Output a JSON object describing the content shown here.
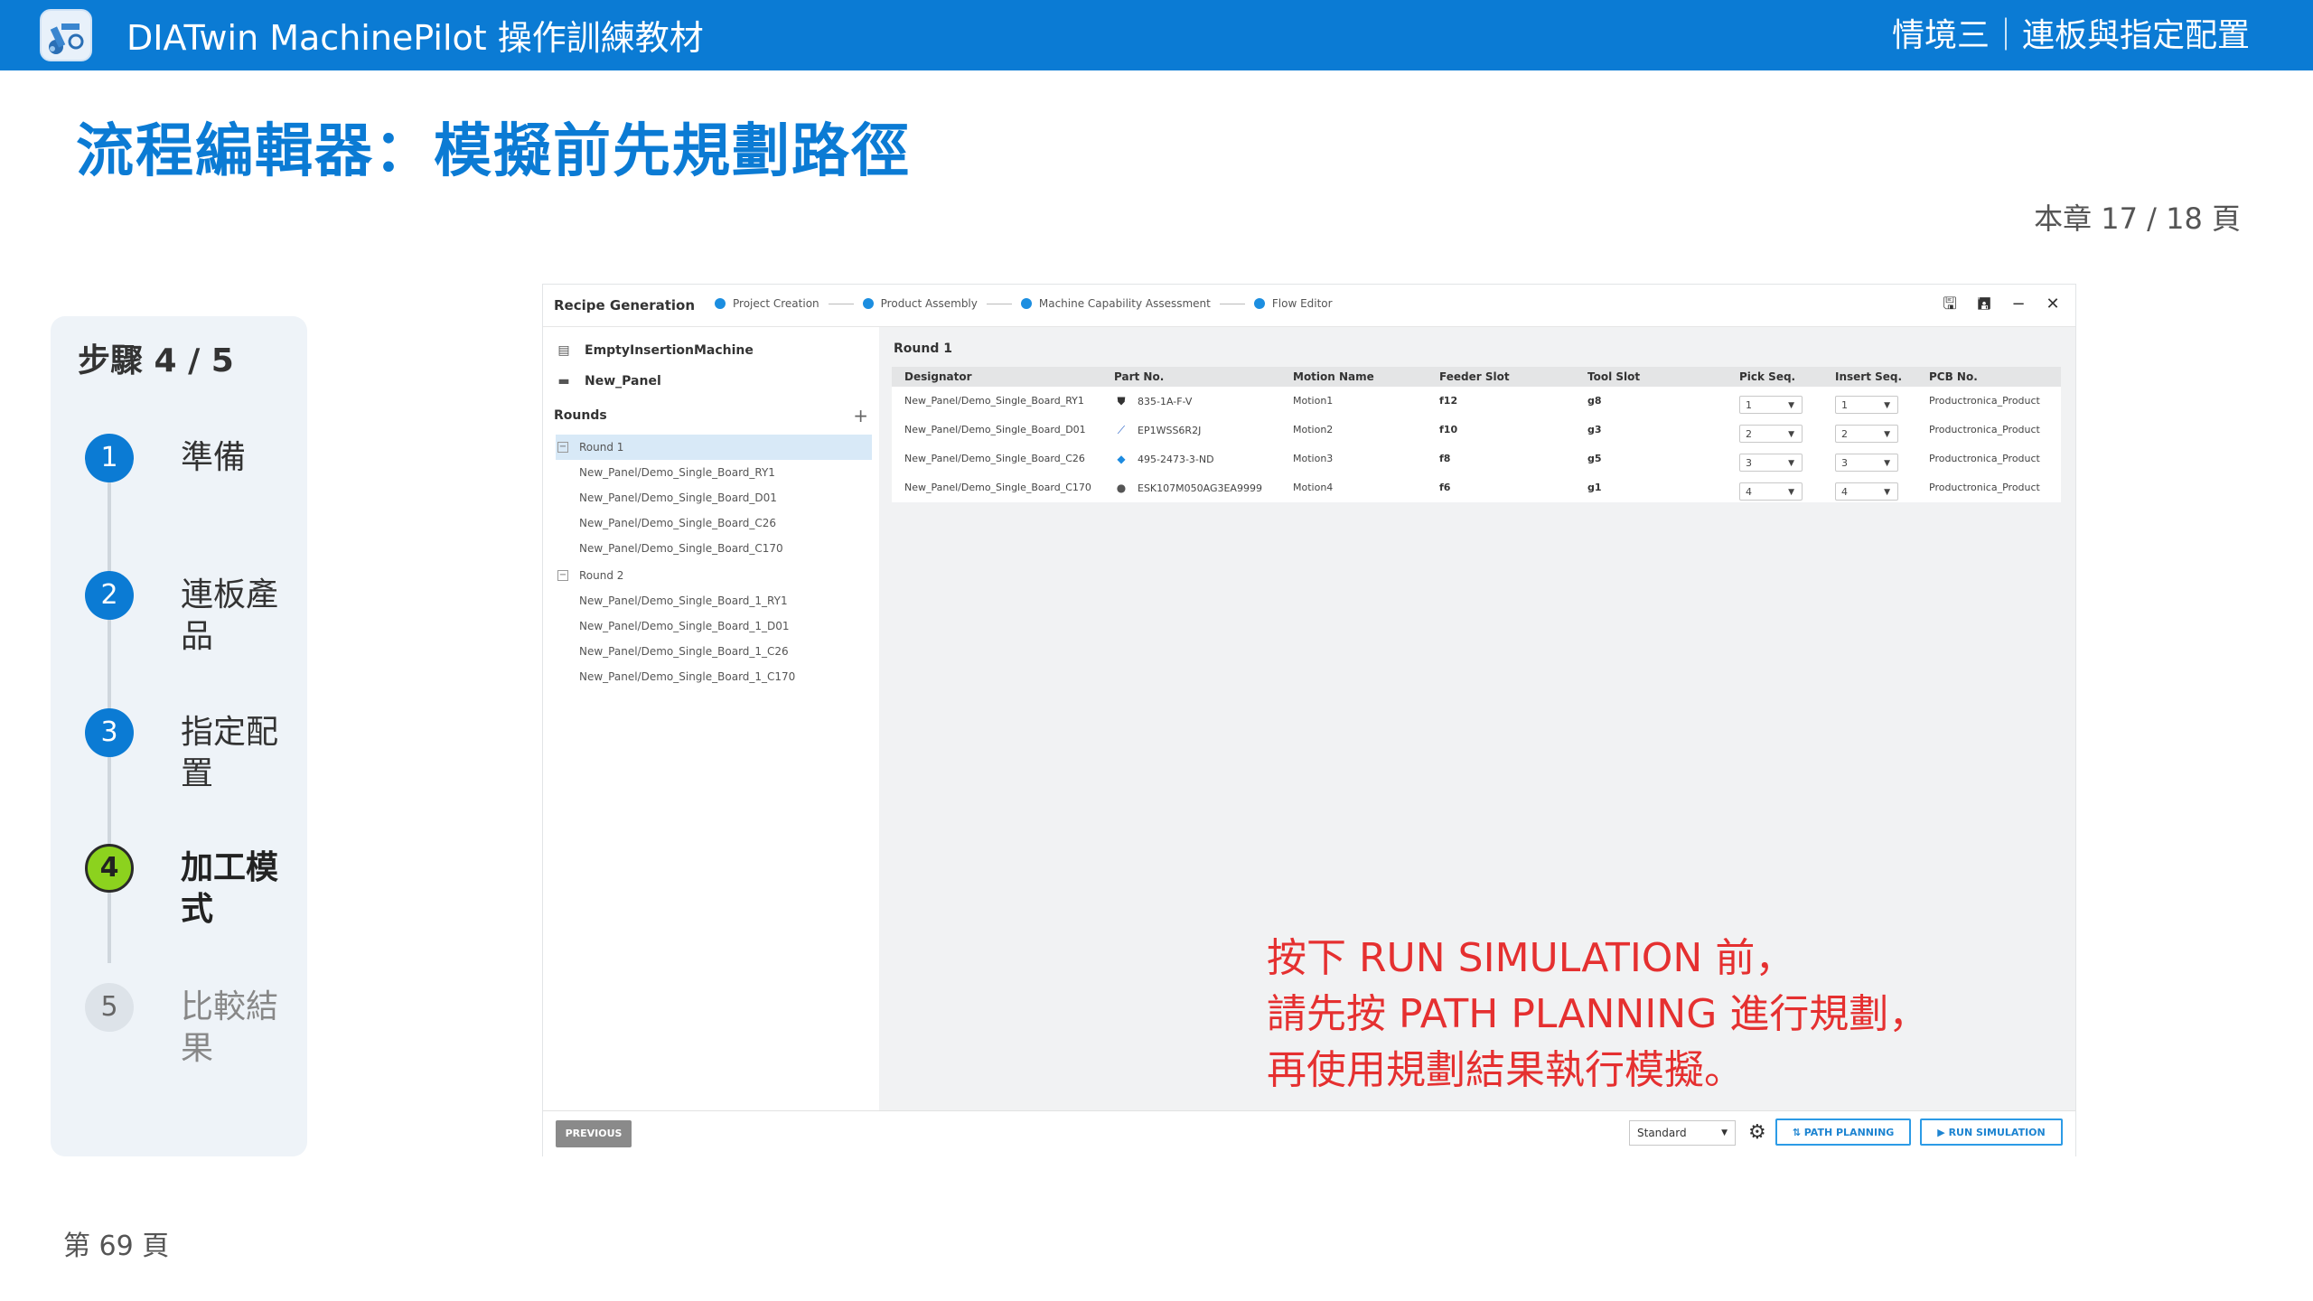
{
  "topbar": {
    "app_title": "DIATwin MachinePilot 操作訓練教材",
    "section": "情境三｜連板與指定配置"
  },
  "page_title": "流程編輯器：模擬前先規劃路徑",
  "chapter_page": "本章 17 / 18 頁",
  "footer_page": "第 69 頁",
  "steps": {
    "title": "步驟 4 / 5",
    "items": [
      {
        "num": "1",
        "label": "準備",
        "state": "done"
      },
      {
        "num": "2",
        "label": "連板產品",
        "state": "done"
      },
      {
        "num": "3",
        "label": "指定配置",
        "state": "done"
      },
      {
        "num": "4",
        "label": "加工模式",
        "state": "active"
      },
      {
        "num": "5",
        "label": "比較結果",
        "state": "pending"
      }
    ]
  },
  "app": {
    "header_title": "Recipe Generation",
    "wizard_steps": [
      "Project Creation",
      "Product Assembly",
      "Machine Capability Assessment",
      "Flow Editor"
    ],
    "window_buttons": {
      "save": "🖫",
      "save_as": "🖪",
      "minimize": "−",
      "close": "✕"
    },
    "machine": "EmptyInsertionMachine",
    "panel": "New_Panel",
    "rounds_label": "Rounds",
    "add_symbol": "+",
    "tree": [
      {
        "type": "round",
        "label": "Round 1",
        "selected": true
      },
      {
        "type": "child",
        "label": "New_Panel/Demo_Single_Board_RY1"
      },
      {
        "type": "child",
        "label": "New_Panel/Demo_Single_Board_D01"
      },
      {
        "type": "child",
        "label": "New_Panel/Demo_Single_Board_C26"
      },
      {
        "type": "child",
        "label": "New_Panel/Demo_Single_Board_C170"
      },
      {
        "type": "round",
        "label": "Round 2",
        "selected": false
      },
      {
        "type": "child",
        "label": "New_Panel/Demo_Single_Board_1_RY1"
      },
      {
        "type": "child",
        "label": "New_Panel/Demo_Single_Board_1_D01"
      },
      {
        "type": "child",
        "label": "New_Panel/Demo_Single_Board_1_C26"
      },
      {
        "type": "child",
        "label": "New_Panel/Demo_Single_Board_1_C170"
      }
    ],
    "round_title": "Round 1",
    "columns": [
      "Designator",
      "Part No.",
      "Motion Name",
      "Feeder Slot",
      "Tool Slot",
      "Pick Seq.",
      "Insert Seq.",
      "PCB No."
    ],
    "rows": [
      {
        "designator": "New_Panel/Demo_Single_Board_RY1",
        "part_icon": "⛊",
        "part_no": "835-1A-F-V",
        "motion": "Motion1",
        "feeder": "f12",
        "tool": "g8",
        "pick": "1",
        "insert": "1",
        "pcb": "Productronica_Product"
      },
      {
        "designator": "New_Panel/Demo_Single_Board_D01",
        "part_icon": "⟋",
        "part_no": "EP1WSS6R2J",
        "motion": "Motion2",
        "feeder": "f10",
        "tool": "g3",
        "pick": "2",
        "insert": "2",
        "pcb": "Productronica_Product"
      },
      {
        "designator": "New_Panel/Demo_Single_Board_C26",
        "part_icon": "◆",
        "part_no": "495-2473-3-ND",
        "motion": "Motion3",
        "feeder": "f8",
        "tool": "g5",
        "pick": "3",
        "insert": "3",
        "pcb": "Productronica_Product"
      },
      {
        "designator": "New_Panel/Demo_Single_Board_C170",
        "part_icon": "●",
        "part_no": "ESK107M050AG3EA9999",
        "motion": "Motion4",
        "feeder": "f6",
        "tool": "g1",
        "pick": "4",
        "insert": "4",
        "pcb": "Productronica_Product"
      }
    ],
    "bottom": {
      "previous": "PREVIOUS",
      "mode": "Standard",
      "path_planning": "PATH PLANNING",
      "run_simulation": "RUN SIMULATION"
    }
  },
  "annotation": [
    "按下 RUN SIMULATION 前，",
    "請先按 PATH PLANNING 進行規劃，",
    "再使用規劃結果執行模擬。"
  ],
  "colors": {
    "brand_blue": "#0b7bd4",
    "active_step": "#8cd21e",
    "annotation_red": "#e53030",
    "selected_row": "#d8e9f7"
  }
}
